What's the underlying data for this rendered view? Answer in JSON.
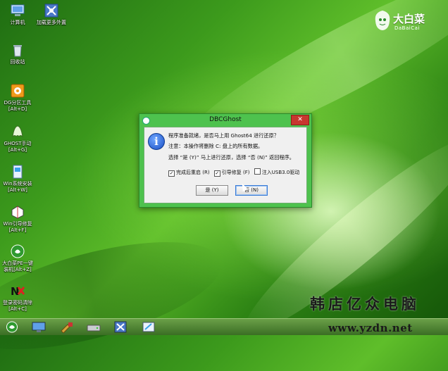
{
  "desktop": {
    "icons": [
      {
        "label": "计算机"
      },
      {
        "label": "加载更多外置"
      },
      {
        "label": "回收站"
      },
      {
        "label": "DG分区工具\n[Alt+D]"
      },
      {
        "label": "GHOST手动\n[Alt+G]"
      },
      {
        "label": "Win系统安装\n[Alt+W]"
      },
      {
        "label": "Win引导修复\n[Alt+F]"
      },
      {
        "label": "大白菜PE一键\n装机[Alt+Z]"
      },
      {
        "label": "登录密码清除\n[Alt+C]"
      }
    ]
  },
  "logo": {
    "brand": "大白菜",
    "pinyin": "DaBaiCai"
  },
  "dialog": {
    "title": "DBCGhost",
    "close_label": "✕",
    "message_line1": "程序准备就绪，是否马上用 Ghost64 进行还原？",
    "message_line2": "注意：本操作将删除 C: 盘上的所有数据。",
    "message_line3": "选择 “是 (Y)” 马上进行还原，选择 “否 (N)” 返回程序。",
    "checkbox_restart": {
      "label": "完成后重启 (R)",
      "checked": true
    },
    "checkbox_boot": {
      "label": "引导修复 (F)",
      "checked": true
    },
    "checkbox_usb3": {
      "label": "注入USB3.0驱动",
      "checked": false
    },
    "yes_label": "是 (Y)",
    "no_label": "否 (N)"
  },
  "watermark": {
    "text": "韩店亿众电脑"
  },
  "taskbar": {
    "url": "www.yzdn.net"
  },
  "colors": {
    "dialog_frame": "#4ec24e",
    "close": "#c7372f",
    "info_icon": "#1a4fc4"
  }
}
